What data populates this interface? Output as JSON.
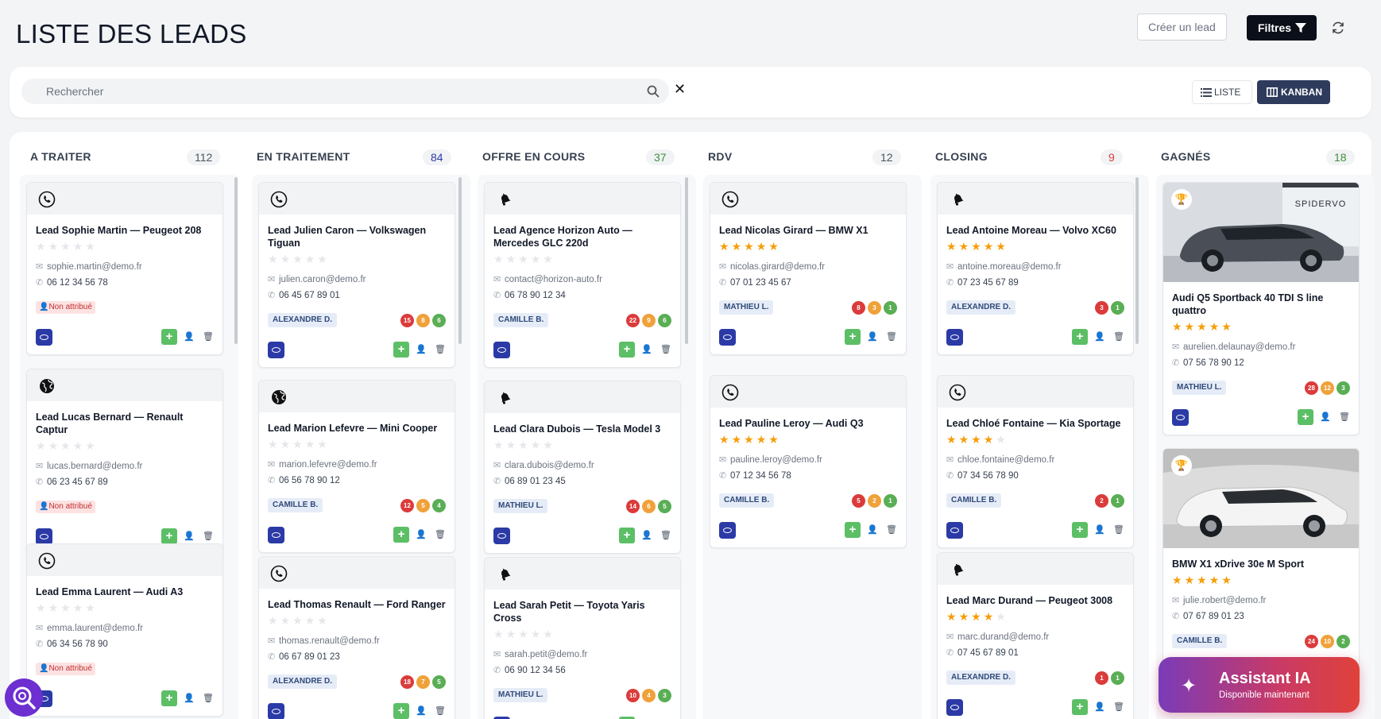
{
  "header": {
    "title": "LISTE DES LEADS",
    "create_label": "Créer un lead",
    "filters_label": "Filtres"
  },
  "search": {
    "placeholder": "Rechercher",
    "clear_label": "✕"
  },
  "view": {
    "list_label": "LISTE",
    "kanban_label": "KANBAN",
    "active": "kanban"
  },
  "colors": {
    "accent": "#2f3b5c",
    "eye": "#2b3aa6",
    "star": "#f59e0b",
    "add": "#5cbf66",
    "counter_red": "#dc3b3b",
    "counter_orange": "#f0a13a",
    "counter_green": "#5aae55"
  },
  "columns": [
    {
      "title": "A TRAITER",
      "count": "112",
      "count_color": "#4b5563",
      "cards": [
        {
          "icon": "phone-icon",
          "title": "Lead Sophie Martin — Peugeot 208",
          "stars": 0,
          "email": "sophie.martin@demo.fr",
          "phone": "06 12 34 56 78",
          "tag": "Non attribué",
          "unassigned": true,
          "counters": []
        },
        {
          "icon": "globe-icon",
          "title": "Lead Lucas Bernard — Renault Captur",
          "stars": 0,
          "email": "lucas.bernard@demo.fr",
          "phone": "06 23 45 67 89",
          "tag": "Non attribué",
          "unassigned": true,
          "counters": []
        },
        {
          "icon": "phone-icon",
          "title": "Lead Emma Laurent — Audi A3",
          "stars": 0,
          "email": "emma.laurent@demo.fr",
          "phone": "06 34 56 78 90",
          "tag": "Non attribué",
          "unassigned": true,
          "counters": []
        }
      ]
    },
    {
      "title": "EN TRAITEMENT",
      "count": "84",
      "count_color": "#2b3aa6",
      "cards": [
        {
          "icon": "phone-icon",
          "title": "Lead Julien Caron — Volkswagen Tiguan",
          "stars": 0,
          "email": "julien.caron@demo.fr",
          "phone": "06 45 67 89 01",
          "tag": "ALEXANDRE D.",
          "unassigned": false,
          "counters": [
            "15",
            "8",
            "6"
          ]
        },
        {
          "icon": "globe-icon",
          "title": "Lead Marion Lefevre — Mini Cooper",
          "stars": 0,
          "email": "marion.lefevre@demo.fr",
          "phone": "06 56 78 90 12",
          "tag": "CAMILLE B.",
          "unassigned": false,
          "counters": [
            "12",
            "5",
            "4"
          ]
        },
        {
          "icon": "phone-icon",
          "title": "Lead Thomas Renault — Ford Ranger",
          "stars": 0,
          "email": "thomas.renault@demo.fr",
          "phone": "06 67 89 01 23",
          "tag": "ALEXANDRE D.",
          "unassigned": false,
          "counters": [
            "18",
            "7",
            "5"
          ]
        }
      ]
    },
    {
      "title": "OFFRE EN COURS",
      "count": "37",
      "count_color": "#3f8f3a",
      "cards": [
        {
          "icon": "bell-icon",
          "title": "Lead Agence Horizon Auto — Mercedes GLC 220d",
          "stars": 0,
          "email": "contact@horizon-auto.fr",
          "phone": "06 78 90 12 34",
          "tag": "CAMILLE B.",
          "unassigned": false,
          "counters": [
            "22",
            "9",
            "6"
          ]
        },
        {
          "icon": "bell-icon",
          "title": "Lead Clara Dubois — Tesla Model 3",
          "stars": 0,
          "email": "clara.dubois@demo.fr",
          "phone": "06 89 01 23 45",
          "tag": "MATHIEU L.",
          "unassigned": false,
          "counters": [
            "14",
            "6",
            "5"
          ]
        },
        {
          "icon": "bell-icon",
          "title": "Lead Sarah Petit — Toyota Yaris Cross",
          "stars": 0,
          "email": "sarah.petit@demo.fr",
          "phone": "06 90 12 34 56",
          "tag": "MATHIEU L.",
          "unassigned": false,
          "counters": [
            "10",
            "4",
            "3"
          ]
        }
      ]
    },
    {
      "title": "RDV",
      "count": "12",
      "count_color": "#4b5563",
      "cards": [
        {
          "icon": "phone-icon",
          "title": "Lead Nicolas Girard — BMW X1",
          "stars": 5,
          "email": "nicolas.girard@demo.fr",
          "phone": "07 01 23 45 67",
          "tag": "MATHIEU L.",
          "unassigned": false,
          "counters": [
            "8",
            "3",
            "1"
          ]
        },
        {
          "icon": "phone-icon",
          "title": "Lead Pauline Leroy — Audi Q3",
          "stars": 5,
          "email": "pauline.leroy@demo.fr",
          "phone": "07 12 34 56 78",
          "tag": "CAMILLE B.",
          "unassigned": false,
          "counters": [
            "5",
            "2",
            "1"
          ]
        }
      ]
    },
    {
      "title": "CLOSING",
      "count": "9",
      "count_color": "#dc3b3b",
      "cards": [
        {
          "icon": "bell-icon",
          "title": "Lead Antoine Moreau — Volvo XC60",
          "stars": 5,
          "email": "antoine.moreau@demo.fr",
          "phone": "07 23 45 67 89",
          "tag": "ALEXANDRE D.",
          "unassigned": false,
          "counters": [
            "3",
            "1"
          ]
        },
        {
          "icon": "phone-icon",
          "title": "Lead Chloé Fontaine — Kia Sportage",
          "stars": 4,
          "email": "chloe.fontaine@demo.fr",
          "phone": "07 34 56 78 90",
          "tag": "CAMILLE B.",
          "unassigned": false,
          "counters": [
            "2",
            "1"
          ]
        },
        {
          "icon": "bell-icon",
          "title": "Lead Marc Durand — Peugeot 3008",
          "stars": 4,
          "email": "marc.durand@demo.fr",
          "phone": "07 45 67 89 01",
          "tag": "ALEXANDRE D.",
          "unassigned": false,
          "counters": [
            "1",
            "1"
          ]
        }
      ]
    },
    {
      "title": "GAGNÉS",
      "count": "18",
      "count_color": "#3f8f3a",
      "cards": [
        {
          "image": "car-photo-grey-suv",
          "banner": "SPIDERVO",
          "title": "Audi Q5 Sportback 40 TDI S line quattro",
          "stars": 5,
          "email": "aurelien.delaunay@demo.fr",
          "phone": "07 56 78 90 12",
          "tag": "MATHIEU L.",
          "unassigned": false,
          "counters": [
            "28",
            "12",
            "3"
          ]
        },
        {
          "image": "car-photo-white-suv",
          "banner": "",
          "title": "BMW X1 xDrive 30e M Sport",
          "stars": 5,
          "email": "julie.robert@demo.fr",
          "phone": "07 67 89 01 23",
          "tag": "CAMILLE B.",
          "unassigned": false,
          "counters": [
            "24",
            "10",
            "2"
          ]
        }
      ]
    }
  ],
  "assistant": {
    "title": "Assistant IA",
    "subtitle": "Disponible maintenant"
  }
}
